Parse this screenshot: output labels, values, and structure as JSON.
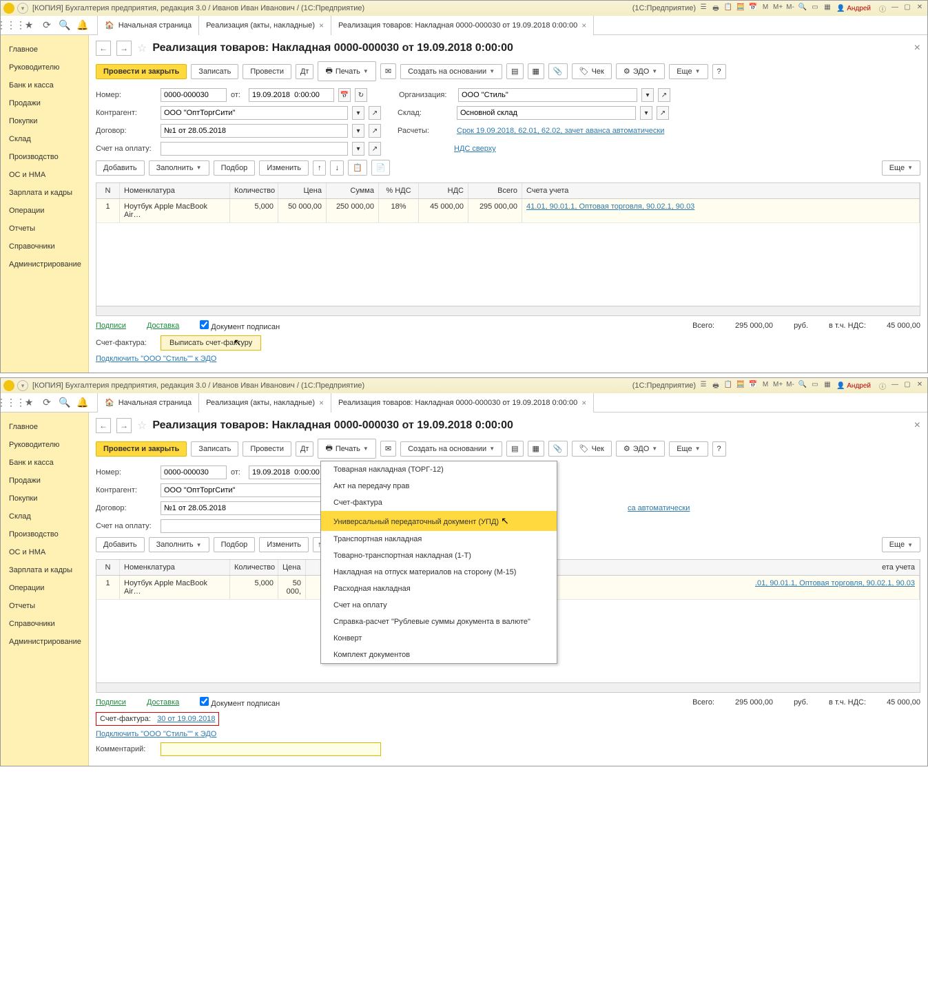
{
  "titlebar": {
    "app": "[КОПИЯ] Бухгалтерия предприятия, редакция 3.0 / Иванов Иван Иванович / (1С:Предприятие)",
    "platform": "(1С:Предприятие)",
    "user": "Андрей"
  },
  "tabs": {
    "home": "Начальная страница",
    "t1": "Реализация (акты, накладные)",
    "t2": "Реализация товаров: Накладная 0000-000030 от 19.09.2018 0:00:00"
  },
  "sidebar": {
    "items": [
      "Главное",
      "Руководителю",
      "Банк и касса",
      "Продажи",
      "Покупки",
      "Склад",
      "Производство",
      "ОС и НМА",
      "Зарплата и кадры",
      "Операции",
      "Отчеты",
      "Справочники",
      "Администрирование"
    ]
  },
  "page": {
    "title": "Реализация товаров: Накладная 0000-000030 от 19.09.2018 0:00:00"
  },
  "toolbar": {
    "post_close": "Провести и закрыть",
    "save": "Записать",
    "post": "Провести",
    "print": "Печать",
    "create_based": "Создать на основании",
    "check": "Чек",
    "edo": "ЭДО",
    "more": "Еще"
  },
  "form": {
    "number_label": "Номер:",
    "number": "0000-000030",
    "date_label": "от:",
    "date": "19.09.2018  0:00:00",
    "org_label": "Организация:",
    "org": "ООО \"Стиль\"",
    "contr_label": "Контрагент:",
    "contr": "ООО \"ОптТоргСити\"",
    "sklad_label": "Склад:",
    "sklad": "Основной склад",
    "dog_label": "Договор:",
    "dog": "№1 от 28.05.2018",
    "calc_label": "Расчеты:",
    "calc_link": "Срок 19.09.2018, 62.01, 62.02, зачет аванса автоматически",
    "account_label": "Счет на оплату:",
    "vat_link": "НДС сверху"
  },
  "tabletools": {
    "add": "Добавить",
    "fill": "Заполнить",
    "select": "Подбор",
    "edit": "Изменить",
    "more": "Еще"
  },
  "headers": {
    "n": "N",
    "nom": "Номенклатура",
    "qty": "Количество",
    "price": "Цена",
    "sum": "Сумма",
    "vatpct": "% НДС",
    "nds": "НДС",
    "total": "Всего",
    "acc": "Счета учета"
  },
  "row": {
    "n": "1",
    "nom": "Ноутбук Apple MacBook Air…",
    "qty": "5,000",
    "price": "50 000,00",
    "sum": "250 000,00",
    "vatpct": "18%",
    "nds": "45 000,00",
    "total": "295 000,00",
    "acc": "41.01, 90.01.1, Оптовая торговля, 90.02.1, 90.03"
  },
  "footer": {
    "signs": "Подписи",
    "delivery": "Доставка",
    "signed": "Документ подписан",
    "total_label": "Всего:",
    "total_value": "295 000,00",
    "currency": "руб.",
    "vat_incl": "в т.ч. НДС:",
    "vat_value": "45 000,00"
  },
  "sf1": {
    "label": "Счет-фактура:",
    "btn": "Выписать счет-фактуру",
    "edo_link": "Подключить \"ООО \"Стиль\"\" к ЭДО"
  },
  "print_menu": {
    "items": [
      "Товарная накладная (ТОРГ-12)",
      "Акт на передачу прав",
      "Счет-фактура",
      "Универсальный передаточный документ (УПД)",
      "Транспортная накладная",
      "Товарно-транспортная накладная (1-Т)",
      "Накладная на отпуск материалов на сторону (М-15)",
      "Расходная накладная",
      "Счет на оплату",
      "Справка-расчет \"Рублевые суммы документа в валюте\"",
      "Конверт",
      "Комплект документов"
    ]
  },
  "sf2": {
    "label": "Счет-фактура:",
    "link": "30 от 19.09.2018",
    "edo_link": "Подключить \"ООО \"Стиль\"\" к ЭДО",
    "comment_label": "Комментарий:"
  }
}
